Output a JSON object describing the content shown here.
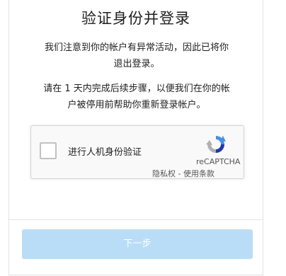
{
  "dialog": {
    "title": "验证身份并登录",
    "message1_line1": "我们注意到你的帐户有异常活动，因此已将你",
    "message1_line2": "退出登录。",
    "message2_line1": "请在 1 天内完成后续步骤，以便我们在你的帐",
    "message2_line2": "户被停用前帮助你重新登录帐户。"
  },
  "recaptcha": {
    "checkbox_label": "进行人机身份验证",
    "brand": "reCAPTCHA",
    "privacy_label": "隐私权",
    "separator": " - ",
    "terms_label": "使用条款",
    "icon": "recaptcha-logo"
  },
  "footer": {
    "next_button_label": "下一步"
  },
  "colors": {
    "button_background": "#b9ddf6",
    "captcha_background": "#f9f9f9",
    "recaptcha_blue": "#4a90e2",
    "recaptcha_dark_blue": "#1c3aa9",
    "recaptcha_grey": "#b0b0b0"
  }
}
